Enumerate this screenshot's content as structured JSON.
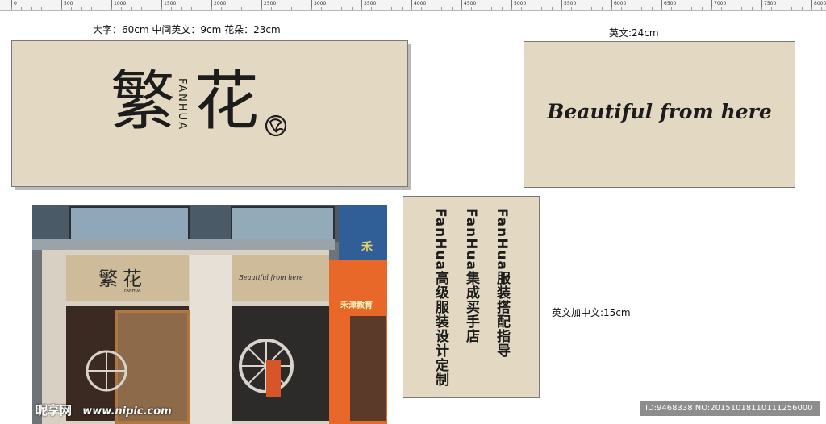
{
  "ruler": {
    "ticks": [
      "0",
      "500",
      "1000",
      "1500",
      "2000",
      "2500",
      "3000",
      "3500",
      "4000",
      "4500",
      "5000",
      "5500",
      "6000",
      "6500",
      "7000",
      "7500",
      "8000"
    ]
  },
  "labels": {
    "sign_spec": "大字：60cm  中间英文：9cm  花朵：23cm",
    "english_spec": "英文:24cm",
    "vertical_spec": "英文加中文:15cm"
  },
  "main_sign": {
    "char1": "繁",
    "latin": "FANHUA",
    "char2": "花"
  },
  "english_sign": {
    "text": "Beautiful from here"
  },
  "vertical_sign": {
    "columns": [
      "FanHua服装搭配指导",
      "FanHua集成买手店",
      "FanHua高级服装设计定制"
    ]
  },
  "photo": {
    "sign_chars": "繁花",
    "sign_latin": "FANHUA",
    "sign_english": "Beautiful from here",
    "neighbor_text": "禾",
    "neighbor_text2": "禾津教育",
    "watermark_logo": "昵享网",
    "watermark_url": "www.nipic.com"
  },
  "watermark_id": "ID:9468338 NO:20151018110111256000",
  "colors": {
    "panel": "#e3d9c2",
    "ink": "#1c1c1c",
    "orange": "#e8682a"
  }
}
